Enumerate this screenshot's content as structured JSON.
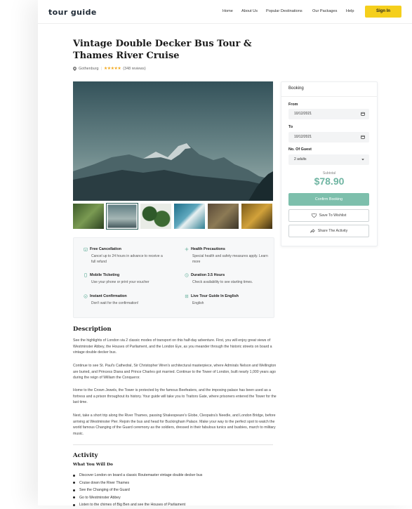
{
  "header": {
    "logo": "tour guide",
    "nav": [
      "Home",
      "About Us",
      "Popular Destinations",
      "Our Packages",
      "Help"
    ],
    "signin_label": "Sign In"
  },
  "tour": {
    "title_line1": "Vintage Double Decker Bus Tour &",
    "title_line2": "Thames River Cruise",
    "location": "Gothenburg",
    "rating": 5,
    "stars": "★★★★★",
    "reviews": "(348 reviews)"
  },
  "features": [
    {
      "title": "Free Cancellation",
      "desc": "Cancel up to 24 hours in advance to receive a full refund",
      "icon": "calendar-check-icon"
    },
    {
      "title": "Health Precautions",
      "desc": "Special health and safety measures apply. Learn more",
      "icon": "health-icon"
    },
    {
      "title": "Mobile Ticketing",
      "desc": "Use your phone or print your voucher",
      "icon": "ticket-icon"
    },
    {
      "title": "Duration 3.5 Hours",
      "desc": "Check availability to see starting times.",
      "icon": "clock-icon"
    },
    {
      "title": "Instant Confirmation",
      "desc": "Don't wait for the confirmation!",
      "icon": "confirm-icon"
    },
    {
      "title": "Live Tour Guide In English",
      "desc": "English",
      "icon": "guide-icon"
    }
  ],
  "description": {
    "heading": "Description",
    "paragraphs": [
      "See the highlights of London via 2 classic modes of transport on this half-day adventure. First, you will enjoy great views of Westminster Abbey, the Houses of Parliament, and the London Eye, as you meander through the historic streets on board a vintage double decker bus.",
      "Continue to see St. Paul's Cathedral, Sir Christopher Wren's architectural masterpiece, where Admirals Nelson and Wellington are buried, and Princess Diana and Prince Charles got married. Continue to the Tower of London, built nearly 1,000 years ago during the reign of William the Conqueror.",
      "Home to the Crown Jewels, the Tower is protected by the famous Beefeaters, and the imposing palace has been used as a fortress and a prison throughout its history. Your guide will take you to Traitors Gate, where prisoners entered the Tower for the last time.",
      "Next, take a short trip along the River Thames, passing Shakespeare's Globe, Cleopatra's Needle, and London Bridge, before arriving at Westminster Pier. Rejoin the bus and head for Buckingham Palace. Make your way to the perfect spot to watch the world famous Changing of the Guard ceremony as the soldiers, dressed in their fabulous tunics and busbies, march to military music."
    ]
  },
  "activity": {
    "heading": "Activity",
    "subheading": "What You Will Do",
    "items": [
      "Discover London on board a classic Routemaster vintage double decker bus",
      "Cruise down the River Thames",
      "See the Changing of the Guard",
      "Go to Westminster Abbey",
      "Listen to the chimes of Big Ben and see the Houses of Parliament"
    ]
  },
  "booking": {
    "title": "Booking",
    "from_label": "From",
    "from_value": "10/12/2021",
    "to_label": "To",
    "to_value": "10/12/2021",
    "guests_label": "No. Of Guest",
    "guests_value": "2 adults",
    "subtotal_label": "Subtotal",
    "subtotal_value": "$78.90",
    "confirm_label": "Confirm Booking",
    "wishlist_label": "Save To Wishlist",
    "share_label": "Share The Activity"
  },
  "colors": {
    "accent": "#7dbfac",
    "price": "#6fb5a2",
    "signin": "#f5cf1c",
    "stars": "#f2a81d"
  }
}
